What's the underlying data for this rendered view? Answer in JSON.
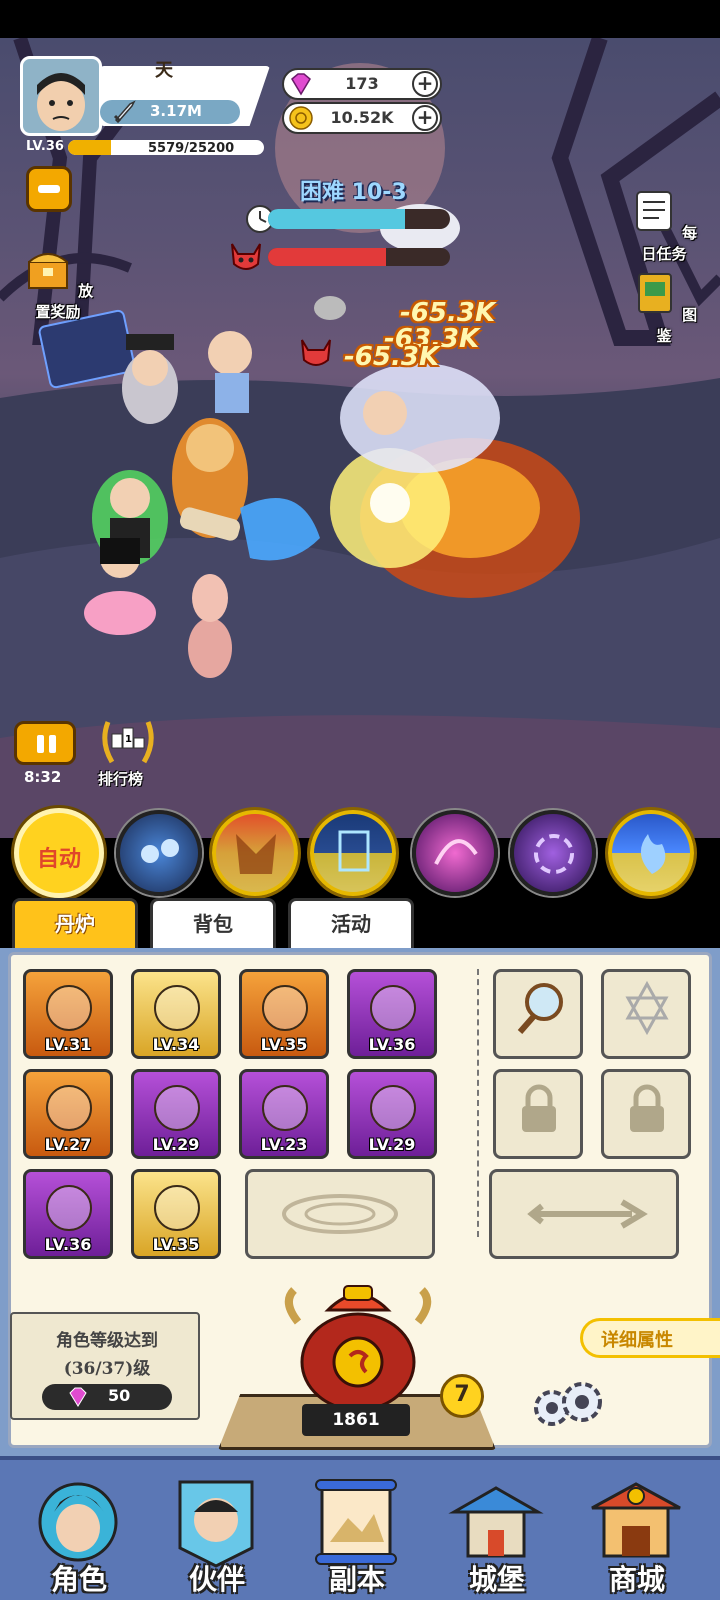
{
  "player": {
    "name": "天",
    "power": "3.17M",
    "level": "LV.36",
    "exp": "5579/25200",
    "exp_progress": 0.22
  },
  "currencies": {
    "gems": "173",
    "gold": "10.52K"
  },
  "side_buttons": {
    "idle_reward": "放置奖励",
    "daily_tasks": "每日任务",
    "codex": "图鉴",
    "ranking": "排行榜"
  },
  "stage": {
    "title": "困难 10-3",
    "timer_progress": 0.75,
    "boss_hp_progress": 0.65,
    "time_left": "8:32"
  },
  "damage_numbers": [
    "-65.3K",
    "-63.3K",
    "-65.3K"
  ],
  "skills": {
    "auto_label": "自动"
  },
  "tabs": [
    "丹炉",
    "背包",
    "活动"
  ],
  "equipment": [
    {
      "level": "LV.31",
      "rarity": "orange",
      "icon": "sword-icon"
    },
    {
      "level": "LV.34",
      "rarity": "gold",
      "icon": "beast-mask-icon"
    },
    {
      "level": "LV.35",
      "rarity": "orange",
      "icon": "armor-icon"
    },
    {
      "level": "LV.36",
      "rarity": "purple",
      "icon": "jade-orb-icon"
    },
    {
      "level": "LV.27",
      "rarity": "orange",
      "icon": "crown-icon"
    },
    {
      "level": "LV.29",
      "rarity": "purple",
      "icon": "spiral-disc-icon"
    },
    {
      "level": "LV.23",
      "rarity": "purple",
      "icon": "prayer-beads-icon"
    },
    {
      "level": "LV.29",
      "rarity": "purple",
      "icon": "fire-pearl-icon"
    },
    {
      "level": "LV.36",
      "rarity": "purple",
      "icon": "ring-icon"
    },
    {
      "level": "LV.35",
      "rarity": "gold",
      "icon": "boots-icon"
    }
  ],
  "requirement": {
    "line1": "角色等级达到",
    "line2": "(36/37)级",
    "cost": "50"
  },
  "detail_button": "详细属性",
  "furnace": {
    "count": "1861",
    "level": "7"
  },
  "nav": [
    "角色",
    "伙伴",
    "副本",
    "城堡",
    "商城"
  ],
  "colors": {
    "accent_gold": "#ffc21a",
    "panel_bg": "#fbf6e4",
    "nav_bg": "#5b77b5",
    "purple_rarity": "#b550d8",
    "orange_rarity": "#f5a23b"
  }
}
